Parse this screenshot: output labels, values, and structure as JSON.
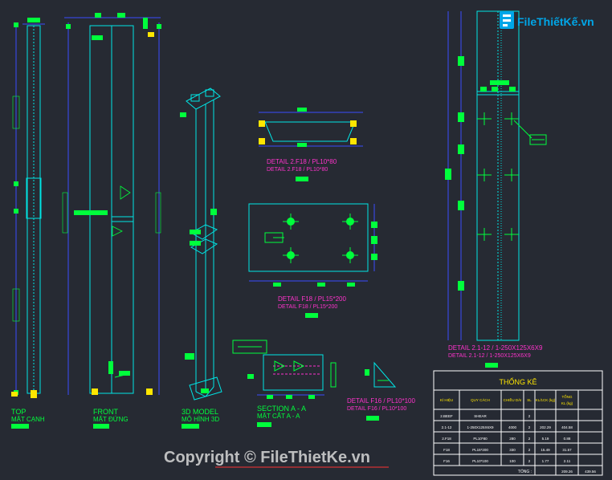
{
  "logo": {
    "text": "FileThiếtKế.vn"
  },
  "watermark": {
    "text": "Copyright © FileThietKe.vn"
  },
  "views": {
    "top": {
      "label": "TOP",
      "sublabel": "MẶT CẠNH"
    },
    "front": {
      "label": "FRONT",
      "sublabel": "MẶT ĐỨNG"
    },
    "model3d": {
      "label": "3D MODEL",
      "sublabel": "MÔ HÌNH 3D"
    },
    "section": {
      "label": "SECTION  A - A",
      "sublabel": "MẶT CẮT  A - A"
    }
  },
  "details": {
    "d2f18": {
      "title": "DETAIL  2.F18 / PL10*80",
      "subtitle": "DETAIL  2.F18 / PL10*80"
    },
    "df18": {
      "title": "DETAIL  F18 / PL15*200",
      "subtitle": "DETAIL  F18 / PL15*200"
    },
    "d212": {
      "title": "DETAIL  2.1-12 / 1-250X125X6X9",
      "subtitle": "DETAIL  2.1-12 / 1-250X125X6X9"
    },
    "df16": {
      "title": "DETAIL  F16 / PL10*100",
      "subtitle": "DETAIL  F16 / PL10*100"
    }
  },
  "table": {
    "title": "THỐNG KÊ",
    "headers": [
      "KÍ HIỆU",
      "QUY CÁCH",
      "CHIỀU DÀI",
      "SL",
      "KL/1CK (kg)",
      "TỔNG KL (kg)"
    ],
    "rows": [
      [
        "2.BEEF",
        "SHEAR",
        "",
        "2",
        "",
        ""
      ],
      [
        "2.1-12",
        "1-250X125X6X9",
        "4000",
        "2",
        "202.29",
        "404.58"
      ],
      [
        "2.F18",
        "PL10*80",
        "280",
        "2",
        "5.19",
        "0.88"
      ],
      [
        "F18",
        "PL15*200",
        "330",
        "2",
        "15.49",
        "31.57"
      ],
      [
        "F16",
        "PL10*100",
        "100",
        "2",
        "1.77",
        "2.11"
      ]
    ],
    "total_label": "TỔNG :",
    "total_values": [
      "209.26",
      "439.56"
    ]
  },
  "colors": {
    "background": "#262a33",
    "line_cyan": "#00e5e5",
    "dim_blue": "#3a4cff",
    "green": "#00ff3c",
    "magenta": "#ff33cc",
    "yellow": "#ffe600",
    "white": "#ffffff"
  }
}
